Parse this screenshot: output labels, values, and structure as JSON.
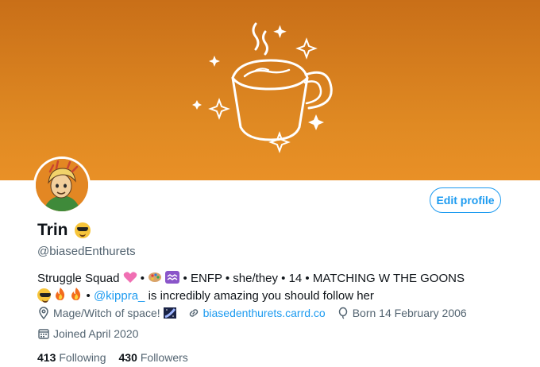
{
  "banner": {
    "colors": {
      "top": "#c96f18",
      "bottom": "#e99026"
    },
    "art": "coffee-mug-doodle"
  },
  "profile": {
    "name": "Trin",
    "name_emoji": "sunglasses-face-emoji",
    "handle": "@biasedEnthurets",
    "edit_label": "Edit profile",
    "bio_line1": "Struggle Squad",
    "bio_line1_rest": "• ENFP • she/they • 14 • MATCHING W THE GOONS",
    "bio_mention": "@kippra_",
    "bio_line2_rest": "is incredibly amazing you should follow her",
    "bio_sep": "•",
    "location": "Mage/Witch of space!",
    "website": "biasedenthurets.carrd.co",
    "birthday": "Born 14 February 2006",
    "joined": "Joined April 2020",
    "following_count": "413",
    "following_label": "Following",
    "followers_count": "430",
    "followers_label": "Followers"
  },
  "colors": {
    "accent": "#1d9bf0",
    "secondary_text": "#536471"
  }
}
